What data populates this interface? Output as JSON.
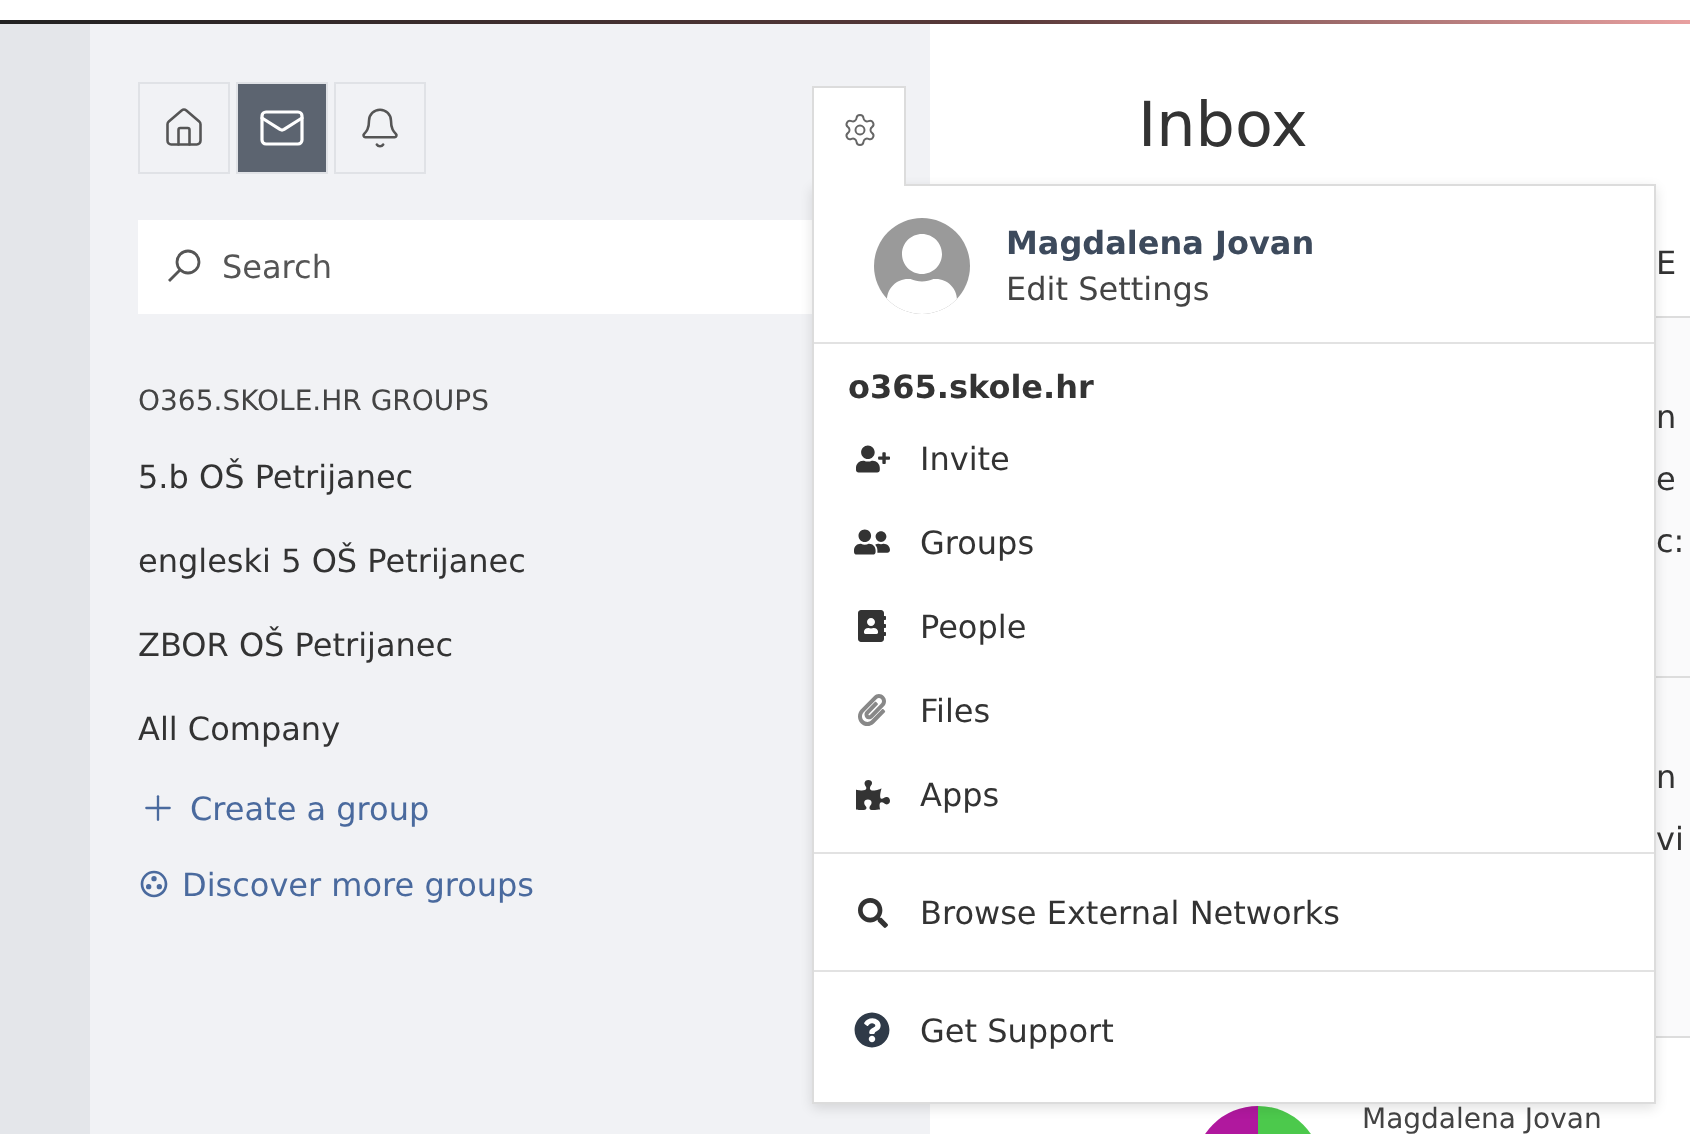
{
  "sidebar": {
    "nav_buttons": [
      {
        "kind": "home",
        "selected": false
      },
      {
        "kind": "mail",
        "selected": true
      },
      {
        "kind": "bell",
        "selected": false
      }
    ],
    "search": {
      "placeholder": "Search"
    },
    "groups_heading": "O365.SKOLE.HR GROUPS",
    "groups": [
      "5.b OŠ Petrijanec",
      "engleski 5 OŠ Petrijanec",
      "ZBOR OŠ Petrijanec",
      "All Company"
    ],
    "actions": [
      {
        "kind": "create",
        "label": "Create a group"
      },
      {
        "kind": "discover",
        "label": "Discover more groups"
      }
    ]
  },
  "main": {
    "title": "Inbox",
    "header_fragment": "E",
    "card_fragments": [
      [
        "n",
        "e",
        "c:"
      ],
      [
        "n",
        "vi"
      ]
    ],
    "footer_author": "Magdalena Jovan"
  },
  "menu": {
    "user": {
      "name": "Magdalena Jovan",
      "link": "Edit Settings"
    },
    "network": "o365.skole.hr",
    "network_items": [
      {
        "kind": "invite",
        "label": "Invite"
      },
      {
        "kind": "groups",
        "label": "Groups"
      },
      {
        "kind": "people",
        "label": "People"
      },
      {
        "kind": "files",
        "label": "Files"
      },
      {
        "kind": "apps",
        "label": "Apps"
      }
    ],
    "external": {
      "kind": "search",
      "label": "Browse External Networks"
    },
    "support": {
      "kind": "help",
      "label": "Get Support"
    }
  }
}
